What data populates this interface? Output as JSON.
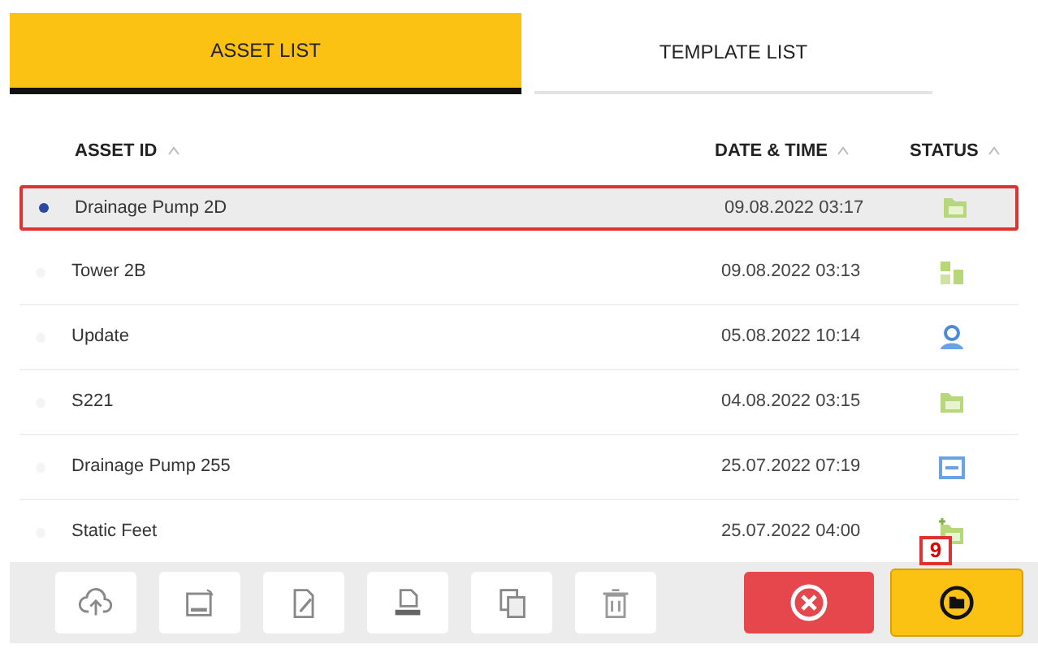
{
  "tabs": [
    {
      "label": "ASSET LIST",
      "selected": true
    },
    {
      "label": "TEMPLATE LIST",
      "selected": false
    }
  ],
  "table": {
    "columns": [
      "ASSET ID",
      "DATE & TIME",
      "STATUS"
    ],
    "rows": [
      {
        "asset_id": "Drainage Pump 2D",
        "date_time": "09.08.2022 03:17",
        "kind": "folder",
        "selected": true
      },
      {
        "asset_id": "Tower 2B",
        "date_time": "09.08.2022 03:13",
        "kind": "split",
        "selected": false
      },
      {
        "asset_id": "Update",
        "date_time": "05.08.2022 10:14",
        "kind": "user",
        "selected": false
      },
      {
        "asset_id": "S221",
        "date_time": "04.08.2022 03:15",
        "kind": "folder",
        "selected": false
      },
      {
        "asset_id": "Drainage Pump 255",
        "date_time": "25.07.2022 07:19",
        "kind": "frame",
        "selected": false
      },
      {
        "asset_id": "Static Feet",
        "date_time": "25.07.2022 04:00",
        "kind": "folder-plus",
        "selected": false
      }
    ]
  },
  "callout": "9",
  "toolbar": [
    {
      "kind": "upload"
    },
    {
      "kind": "card"
    },
    {
      "kind": "edit"
    },
    {
      "kind": "print"
    },
    {
      "kind": "copy"
    },
    {
      "kind": "delete"
    }
  ]
}
